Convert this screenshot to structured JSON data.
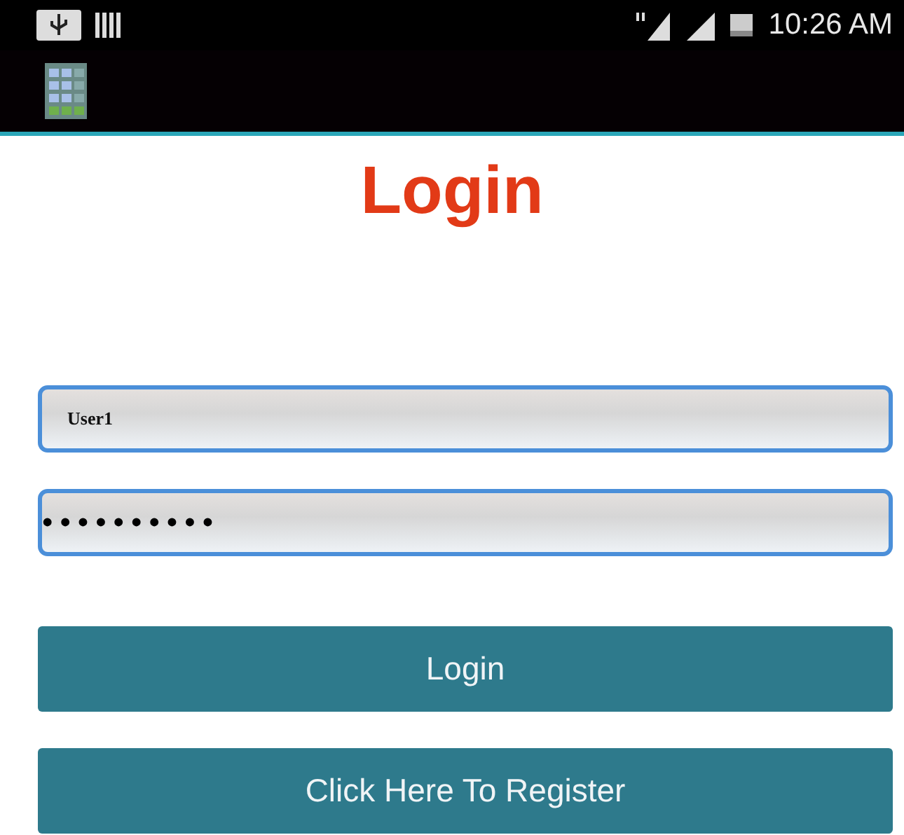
{
  "status_bar": {
    "time": "10:26 AM"
  },
  "title": "Login",
  "fields": [
    {
      "kind": "text",
      "value": "User1"
    },
    {
      "kind": "password",
      "value": "••••••••••"
    }
  ],
  "buttons": [
    "Login",
    "Click Here To Register"
  ]
}
